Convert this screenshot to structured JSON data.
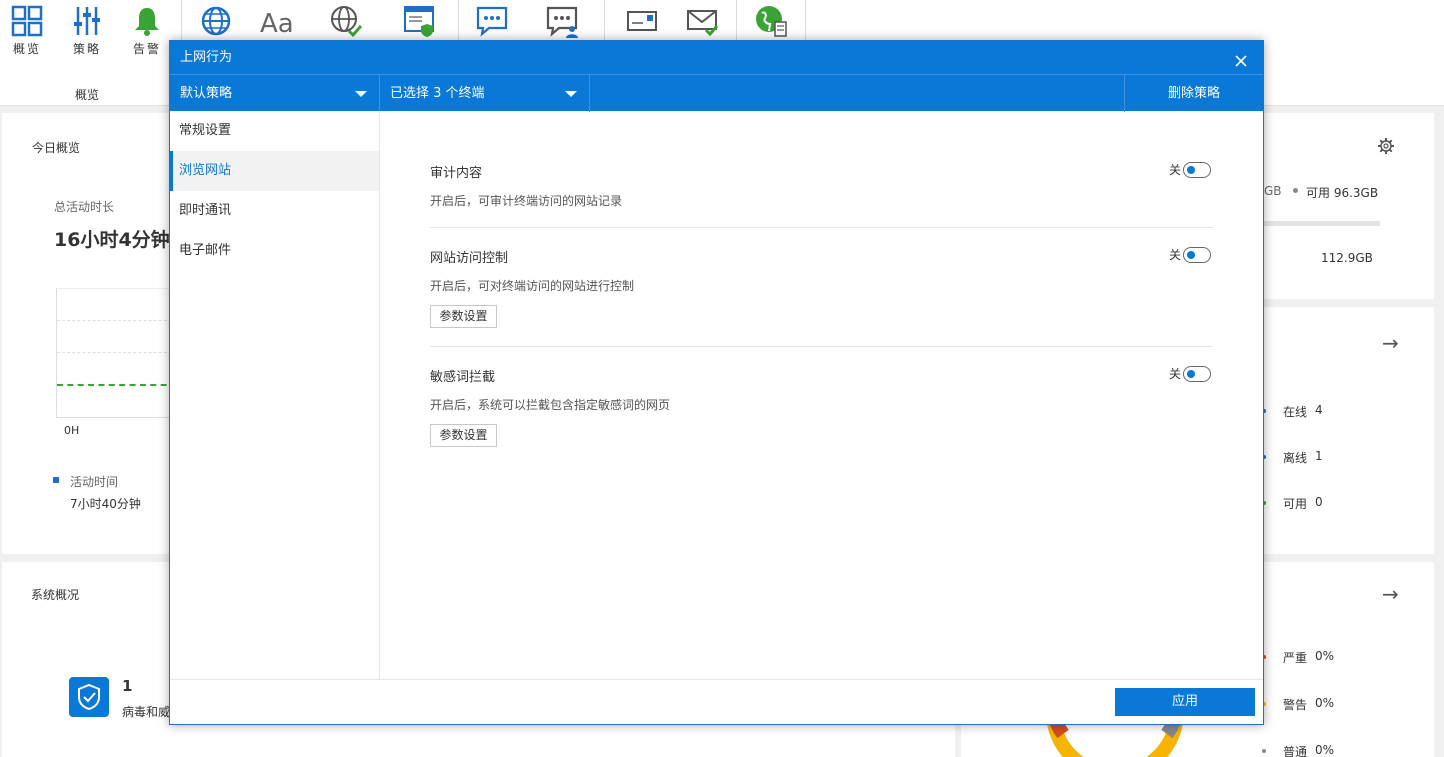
{
  "toolbar": {
    "overview_label": "概览",
    "policy_label": "策略",
    "alert_label": "告警",
    "group_label": "概览"
  },
  "dashboard": {
    "today_title": "今日概览",
    "total_active_label": "总活动时长",
    "total_active_value": "16小时4分钟",
    "chart_axis_zero": "0H",
    "legend_label": "活动时间",
    "legend_value": "7小时40分钟",
    "disk_used_partial": "GB",
    "disk_available": "可用 96.3GB",
    "disk_total": "112.9GB",
    "online_label": "在线",
    "online_value": "4",
    "offline_label": "离线",
    "offline_value": "1",
    "available_label": "可用",
    "available_value": "0",
    "system_title": "系统概况",
    "virus_count": "1",
    "virus_label_partial": "病毒和威",
    "severe_label": "严重",
    "severe_value": "0%",
    "warning_label": "警告",
    "warning_value": "0%",
    "normal_label": "普通",
    "normal_value": "0%"
  },
  "modal": {
    "title": "上网行为",
    "policy_select": "默认策略",
    "terminal_select": "已选择 3 个终端",
    "delete_label": "删除策略",
    "sidebar": [
      {
        "label": "常规设置"
      },
      {
        "label": "浏览网站"
      },
      {
        "label": "即时通讯"
      },
      {
        "label": "电子邮件"
      }
    ],
    "sections": [
      {
        "title": "审计内容",
        "desc": "开启后，可审计终端访问的网站记录",
        "toggle_label": "关"
      },
      {
        "title": "网站访问控制",
        "desc": "开启后，可对终端访问的网站进行控制",
        "toggle_label": "关",
        "button": "参数设置"
      },
      {
        "title": "敏感词拦截",
        "desc": "开启后，系统可以拦截包含指定敏感词的网页",
        "toggle_label": "关",
        "button": "参数设置"
      }
    ],
    "apply_label": "应用"
  },
  "colors": {
    "accent": "#0a78d7",
    "alert_bell": "#3aa335",
    "toggle_dot": "#0a78d7"
  }
}
